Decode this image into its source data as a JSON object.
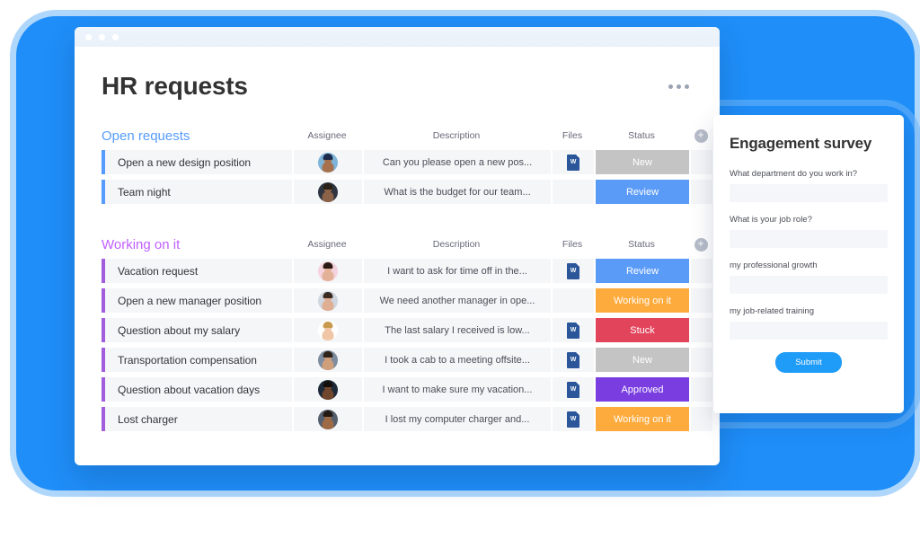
{
  "window": {
    "dots": [
      "dot",
      "dot",
      "dot"
    ],
    "title": "HR requests",
    "more_label": "•••"
  },
  "columns": {
    "assignee": "Assignee",
    "description": "Description",
    "files": "Files",
    "status": "Status",
    "add": "+"
  },
  "colors": {
    "accent_blue": "#579bfc",
    "accent_purple": "#a25ddc",
    "group_blue": "#579bfc",
    "group_purple": "#c05fff",
    "status_new": "#c4c4c4",
    "status_review": "#5b9bf8",
    "status_working": "#fdab3d",
    "status_stuck": "#e2445c",
    "status_approved": "#7a3ee0",
    "page_blue": "#1f8ef8",
    "submit_blue": "#1f9bf8"
  },
  "groups": [
    {
      "name": "Open requests",
      "color_class": "blue",
      "rows": [
        {
          "title": "Open a new design position",
          "description": "Can you please open a new pos...",
          "has_file": true,
          "status": "New",
          "status_color": "#c4c4c4",
          "avatar": {
            "skin": "#a8714d",
            "hair": "#1d2a4a",
            "shirt": "#7fb4d8"
          }
        },
        {
          "title": "Team night",
          "description": "What is the budget for our team...",
          "has_file": false,
          "status": "Review",
          "status_color": "#5b9bf8",
          "avatar": {
            "skin": "#8a6248",
            "hair": "#2a2118",
            "shirt": "#2f3640"
          }
        }
      ]
    },
    {
      "name": "Working on it",
      "color_class": "purple",
      "rows": [
        {
          "title": "Vacation request",
          "description": "I want to ask for time off in the...",
          "has_file": true,
          "status": "Review",
          "status_color": "#5b9bf8",
          "avatar": {
            "skin": "#e3b098",
            "hair": "#2b1a13",
            "shirt": "#f4d3dd"
          }
        },
        {
          "title": "Open a new manager position",
          "description": "We need another manager in ope...",
          "has_file": false,
          "status": "Working on it",
          "status_color": "#fdab3d",
          "avatar": {
            "skin": "#dfae93",
            "hair": "#3a2a20",
            "shirt": "#cfd6df"
          }
        },
        {
          "title": "Question about my salary",
          "description": "The last salary I received is low...",
          "has_file": true,
          "status": "Stuck",
          "status_color": "#e2445c",
          "avatar": {
            "skin": "#f0c6a6",
            "hair": "#c79a4e",
            "shirt": "#ffffff"
          }
        },
        {
          "title": "Transportation compensation",
          "description": "I took a cab to a meeting offsite...",
          "has_file": true,
          "status": "New",
          "status_color": "#c4c4c4",
          "avatar": {
            "skin": "#cf9f7c",
            "hair": "#2f2219",
            "shirt": "#7e8ca0"
          }
        },
        {
          "title": "Question about vacation days",
          "description": "I want to make sure my vacation...",
          "has_file": true,
          "status": "Approved",
          "status_color": "#7a3ee0",
          "avatar": {
            "skin": "#70462c",
            "hair": "#15100c",
            "shirt": "#1e2a3a"
          }
        },
        {
          "title": "Lost charger",
          "description": "I lost my computer charger and...",
          "has_file": true,
          "status": "Working on it",
          "status_color": "#fdab3d",
          "avatar": {
            "skin": "#9e6a45",
            "hair": "#241a14",
            "shirt": "#555f6e"
          }
        }
      ]
    }
  ],
  "survey": {
    "title": "Engagement survey",
    "questions": [
      {
        "label": "What department do you work in?",
        "value": "",
        "placeholder": ""
      },
      {
        "label": "What is your job role?",
        "value": "",
        "placeholder": ""
      },
      {
        "label": "my professional growth",
        "value": "",
        "placeholder": ""
      },
      {
        "label": "my job-related training",
        "value": "",
        "placeholder": ""
      }
    ],
    "submit_label": "Submit"
  }
}
